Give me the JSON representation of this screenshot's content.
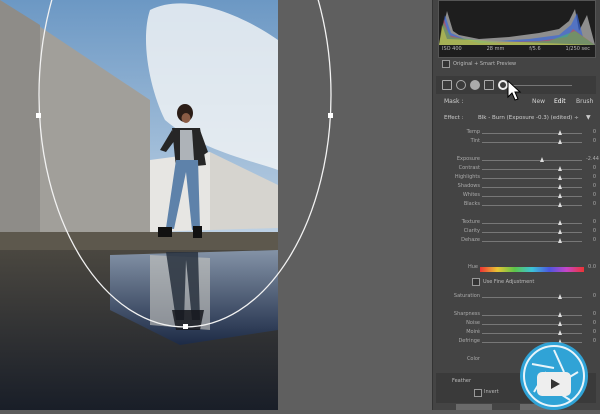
{
  "histogram": {
    "info_left": "ISO 400",
    "info_mid": "28 mm",
    "info_right": "f/5.6",
    "info_far": "1/250 sec"
  },
  "preview": {
    "label": "Original + Smart Preview"
  },
  "mask_modes": {
    "mask": "Mask :",
    "new": "New",
    "edit": "Edit",
    "brush": "Brush"
  },
  "effect": {
    "label": "Effect :",
    "value": "Blk - Burn (Exposure -0.3) (edited) ÷"
  },
  "sliders": [
    {
      "label": "Temp",
      "value": "0"
    },
    {
      "label": "Tint",
      "value": "0"
    },
    {
      "label": "Exposure",
      "value": "-2.44"
    },
    {
      "label": "Contrast",
      "value": "0"
    },
    {
      "label": "Highlights",
      "value": "0"
    },
    {
      "label": "Shadows",
      "value": "0"
    },
    {
      "label": "Whites",
      "value": "0"
    },
    {
      "label": "Blacks",
      "value": "0"
    },
    {
      "label": "Texture",
      "value": "0"
    },
    {
      "label": "Clarity",
      "value": "0"
    },
    {
      "label": "Dehaze",
      "value": "0"
    }
  ],
  "hue": {
    "label": "Hue",
    "value": "0.0"
  },
  "finetune": {
    "label": "Use Fine Adjustment"
  },
  "sliders2": [
    {
      "label": "Saturation",
      "value": "0"
    },
    {
      "label": "Sharpness",
      "value": "0"
    },
    {
      "label": "Noise",
      "value": "0"
    },
    {
      "label": "Moiré",
      "value": "0"
    },
    {
      "label": "Defringe",
      "value": "0"
    }
  ],
  "color_label": "Color",
  "feather": {
    "label": "Feather",
    "invert": "Invert"
  },
  "colors": {
    "accent": "#30a3d6"
  }
}
